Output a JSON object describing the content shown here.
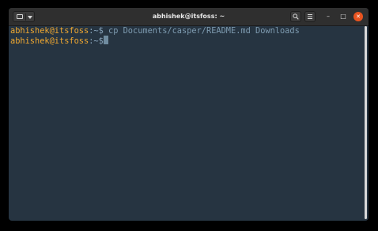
{
  "window": {
    "title": "abhishek@itsfoss: ~"
  },
  "titlebar": {
    "menu_icon": "terminal-icon",
    "search_icon": "search-icon",
    "menu_icon_right": "hamburger-icon",
    "minimize_glyph": "–",
    "maximize_glyph": "□",
    "close_glyph": "✕"
  },
  "terminal": {
    "lines": [
      {
        "user": "abhishek@itsfoss",
        "path": ":~$",
        "command": " cp Documents/casper/README.md Downloads"
      },
      {
        "user": "abhishek@itsfoss",
        "path": ":~$",
        "command": ""
      }
    ]
  },
  "colors": {
    "background": "#263441",
    "prompt_user": "#f0a830",
    "text": "#7e9bb0",
    "close": "#e95420"
  }
}
